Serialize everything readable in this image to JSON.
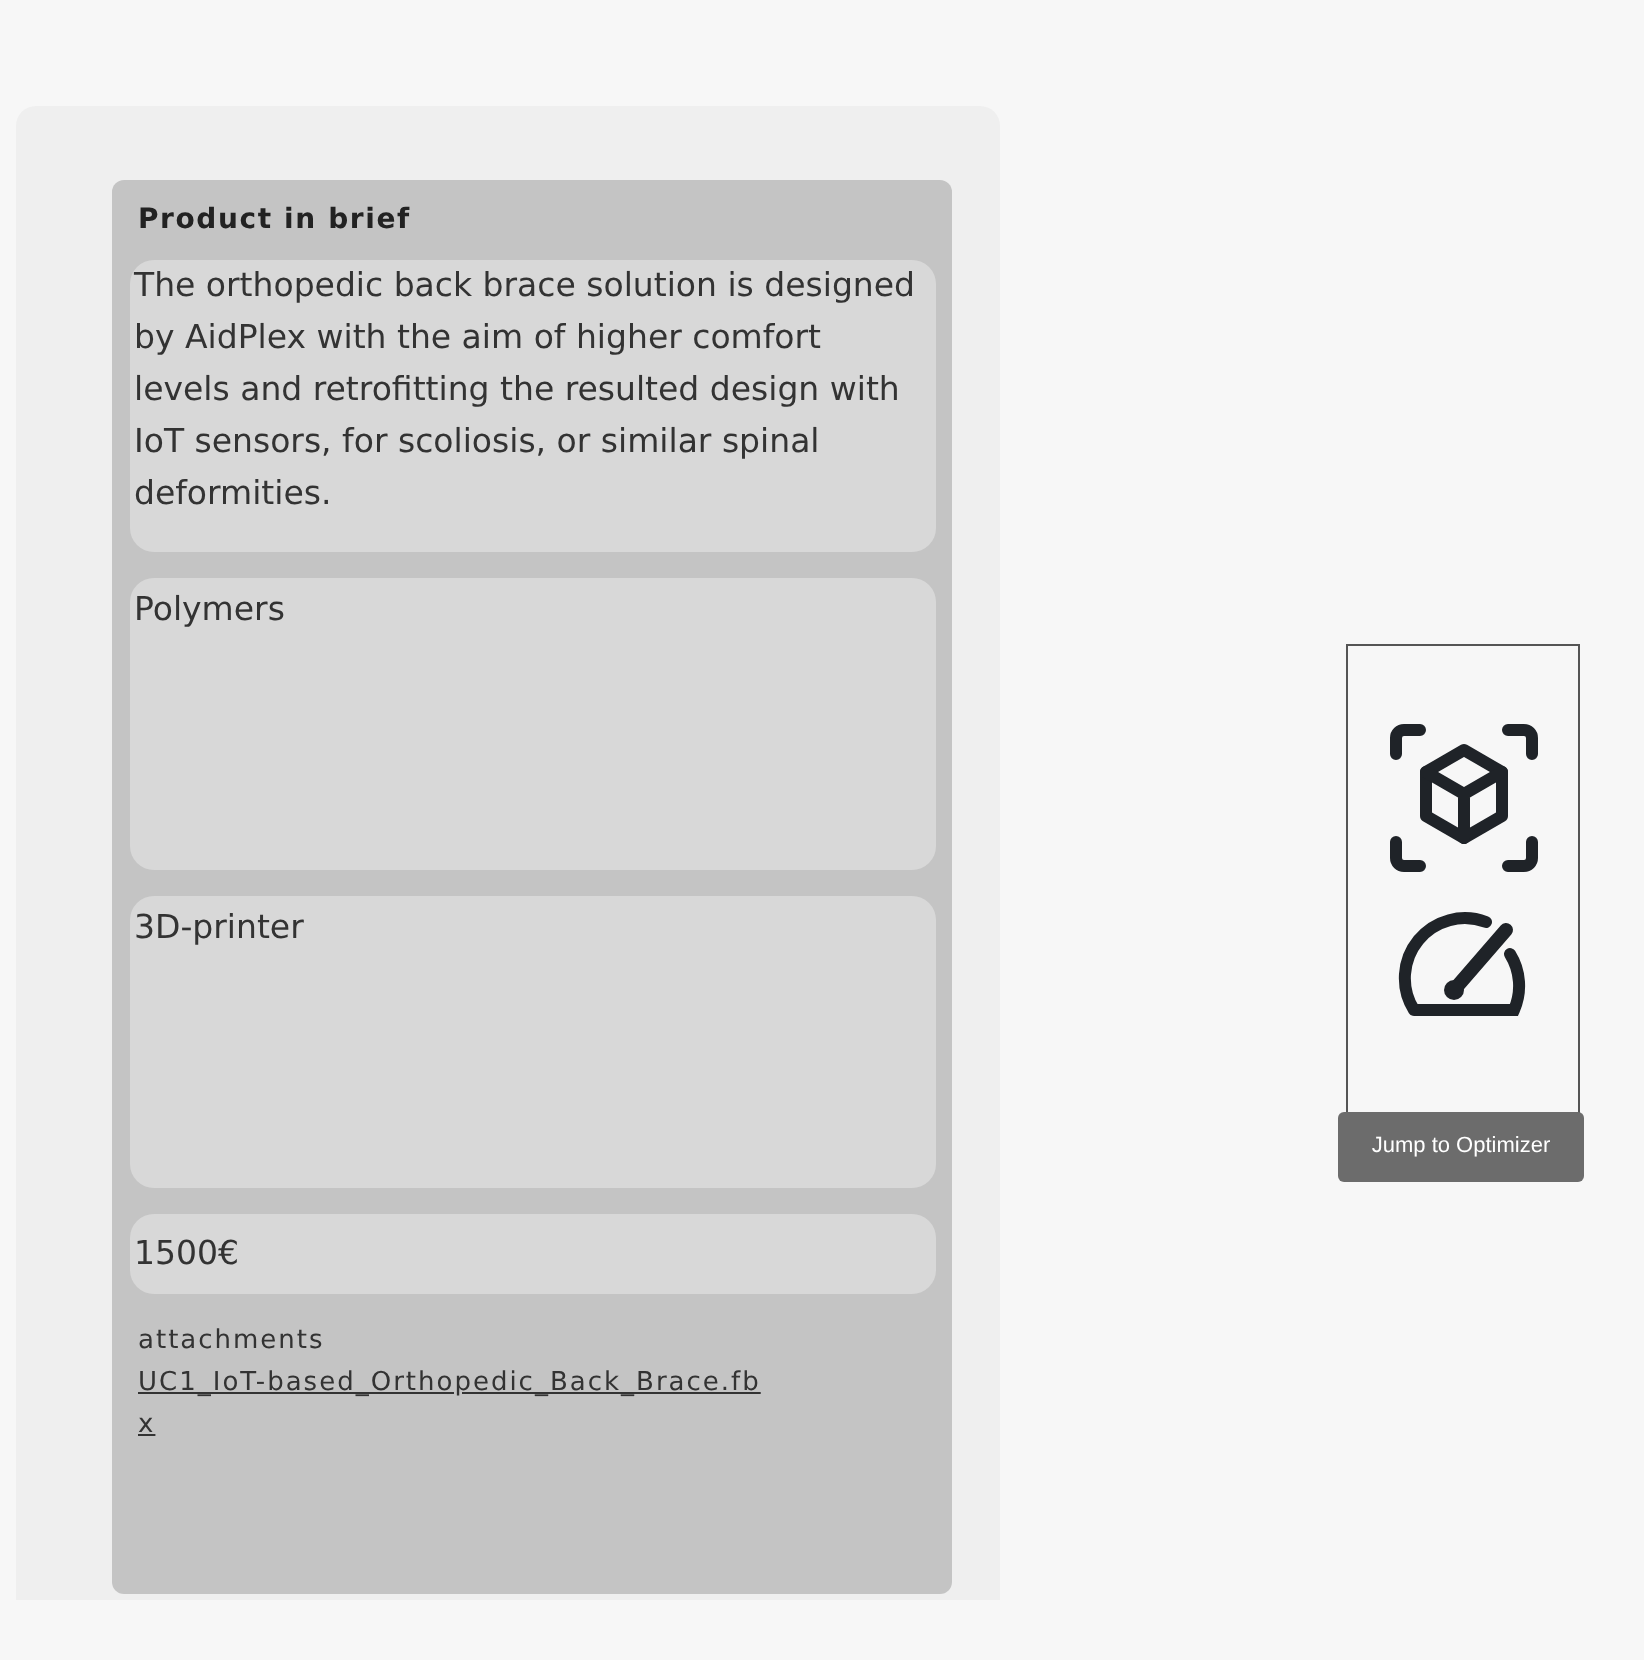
{
  "product": {
    "title": "Product in brief",
    "fields": [
      {
        "kind": "text",
        "value": "The orthopedic back brace solution is designed by AidPlex with the aim of higher comfort levels and retrofitting the resulted design with IoT sensors, for scoliosis, or similar spinal deformities."
      },
      {
        "kind": "area",
        "value": "Polymers"
      },
      {
        "kind": "area",
        "value": "3D-printer"
      },
      {
        "kind": "line",
        "value": "1500€"
      }
    ],
    "attachments": {
      "label": "attachments",
      "files": [
        "UC1_IoT-based_Orthopedic_Back_Brace.fbx"
      ]
    }
  },
  "toolbar": {
    "buttons": [
      {
        "kind": "model"
      },
      {
        "kind": "optimizer"
      }
    ],
    "tooltip": "Jump to Optimizer"
  }
}
